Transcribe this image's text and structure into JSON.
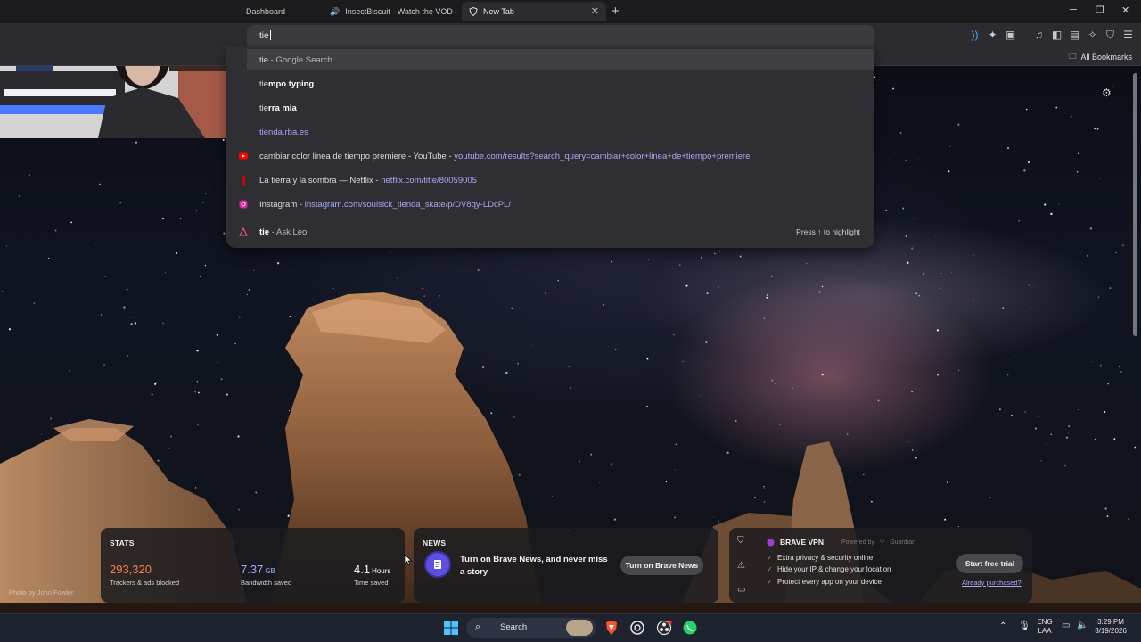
{
  "tabs": [
    {
      "label": "Dashboard",
      "icon": "dashboard-icon"
    },
    {
      "label": "InsectBiscuit - Watch the VOD on",
      "icon": "kick-icon"
    },
    {
      "label": "New Tab",
      "icon": "brave-shield-icon",
      "active": true
    }
  ],
  "window_controls": {
    "minimize": "─",
    "restore": "❐",
    "close": "✕"
  },
  "omnibox": {
    "value": "tie"
  },
  "suggestions": [
    {
      "icon": "google-icon",
      "bold": "",
      "normal": "tie",
      "suffix": " - Google Search",
      "url": ""
    },
    {
      "icon": "search-icon",
      "bold": "mpo typing",
      "normal": "tie",
      "suffix": "",
      "url": ""
    },
    {
      "icon": "search-icon",
      "bold": "rra mia",
      "normal": "tie",
      "suffix": "",
      "url": ""
    },
    {
      "icon": "globe-icon",
      "bold": "",
      "normal": "",
      "suffix": "",
      "url": "tienda.rba.es"
    },
    {
      "icon": "youtube-icon",
      "text": "cambiar color linea de tiempo premiere - YouTube",
      "url": "youtube.com/results?search_query=cambiar+color+linea+de+tiempo+premiere"
    },
    {
      "icon": "netflix-icon",
      "text": "La tierra y la sombra — Netflix",
      "url": "netflix.com/title/80059005"
    },
    {
      "icon": "instagram-icon",
      "text": "Instagram",
      "url": "instagram.com/soulsick_tienda_skate/p/DV8qy-LDcPL/"
    },
    {
      "icon": "leo-icon",
      "bold": "tie",
      "suffix": " - Ask Leo",
      "hint": "Press ↑ to highlight"
    }
  ],
  "bookmarks": {
    "all_label": "All Bookmarks"
  },
  "stats": {
    "title": "STATS",
    "trackers_value": "293,320",
    "trackers_label": "Trackers & ads blocked",
    "bandwidth_value": "7.37",
    "bandwidth_unit": "GB",
    "bandwidth_label": "Bandwidth saved",
    "time_value": "4.1",
    "time_unit": "Hours",
    "time_label": "Time saved"
  },
  "news": {
    "title": "NEWS",
    "text": "Turn on Brave News, and never miss a story",
    "button": "Turn on Brave News"
  },
  "vpn": {
    "title": "BRAVE VPN",
    "powered": "Powered by",
    "powered_brand": "Guardian",
    "features": [
      "Extra privacy & security online",
      "Hide your IP & change your location",
      "Protect every app on your device"
    ],
    "cta": "Start free trial",
    "link": "Already purchased?"
  },
  "photo_credit": "Photo by John Fowler",
  "taskbar": {
    "search_label": "Search",
    "lang_top": "ENG",
    "lang_bottom": "LAA",
    "time": "3:29 PM",
    "date": "3/19/2026"
  },
  "colors": {
    "accent_orange": "#ff7a55",
    "accent_blue": "#a3a9ff",
    "link_purple": "#a8a8f8"
  }
}
